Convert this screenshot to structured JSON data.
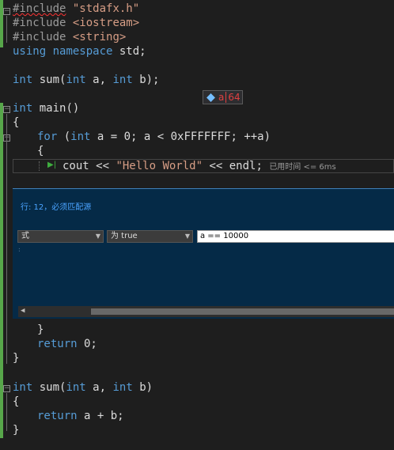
{
  "code": {
    "l1": {
      "pre": "#include",
      "sp": " ",
      "str": "\"stdafx.h\""
    },
    "l2": {
      "pre": "#include",
      "sp": " ",
      "str": "<iostream>"
    },
    "l3": {
      "pre": "#include",
      "sp": " ",
      "str": "<string>"
    },
    "l4": {
      "kw1": "using",
      "kw2": "namespace",
      "rest": " std;"
    },
    "l6": {
      "kw1": "int",
      "t1": " sum(",
      "kw2": "int",
      "t2": " a, ",
      "kw3": "int",
      "t3": " b);"
    },
    "l8": {
      "kw": "int",
      "rest": " main()"
    },
    "l9": "{",
    "l10": {
      "kw1": "for",
      "t1": " (",
      "kw2": "int",
      "t2": " a = 0; a < 0xFFFFFFF; ++a)"
    },
    "l11": "{",
    "l12": {
      "t1": "cout << ",
      "str": "\"Hello World\"",
      "t2": " << endl;",
      "perf": "已用时间 <= 6ms"
    },
    "l13": "}",
    "l14": {
      "kw": "return",
      "rest": " 0;"
    },
    "l15": "}",
    "l17": {
      "kw1": "int",
      "t1": " sum(",
      "kw2": "int",
      "t2": " a, ",
      "kw3": "int",
      "t3": " b)"
    },
    "l18": "{",
    "l19": {
      "kw": "return",
      "rest": " a + b;"
    },
    "l20": "}"
  },
  "datatip": {
    "name": "a",
    "value": "64"
  },
  "breakpoint_settings": {
    "title": "行: 12，必须匹配源",
    "condition_type": "式",
    "condition_mode": "为 true",
    "condition_expr": "a == 10000"
  },
  "colors": {
    "keyword": "#569cd6",
    "string": "#d69d85",
    "panel_bg": "#052a47",
    "change_bar": "#57a64a"
  }
}
